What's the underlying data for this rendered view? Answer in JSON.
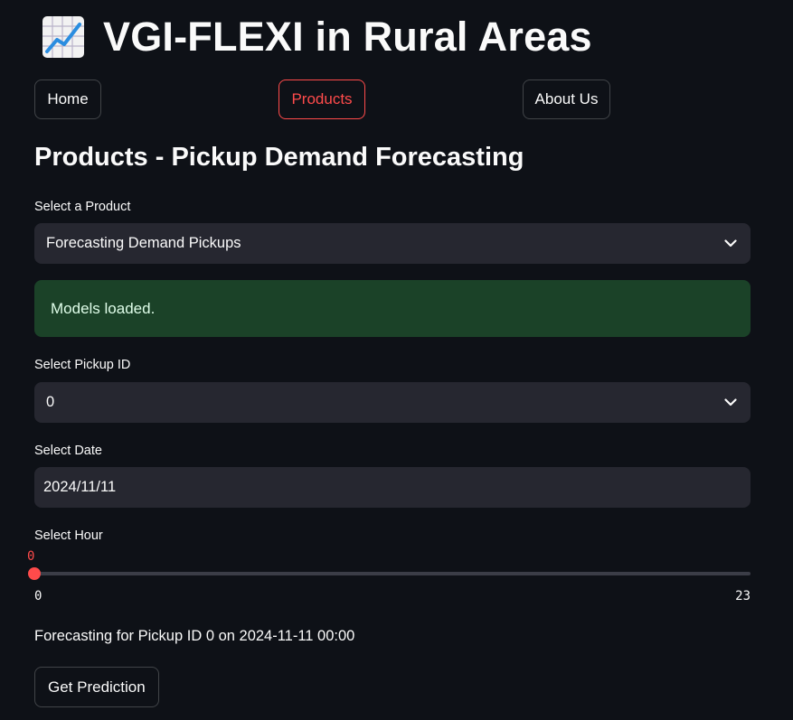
{
  "app": {
    "title": "VGI-FLEXI in Rural Areas",
    "title_icon": "chart-increasing-icon"
  },
  "nav": {
    "items": [
      {
        "label": "Home",
        "active": false
      },
      {
        "label": "Products",
        "active": true
      },
      {
        "label": "About Us",
        "active": false
      }
    ]
  },
  "section": {
    "title": "Products - Pickup Demand Forecasting"
  },
  "product_select": {
    "label": "Select a Product",
    "value": "Forecasting Demand Pickups"
  },
  "status": {
    "message": "Models loaded."
  },
  "pickup_select": {
    "label": "Select Pickup ID",
    "value": "0"
  },
  "date": {
    "label": "Select Date",
    "value": "2024/11/11"
  },
  "hour_slider": {
    "label": "Select Hour",
    "value": 0,
    "value_text": "0",
    "min": 0,
    "max": 23,
    "min_text": "0",
    "max_text": "23"
  },
  "forecast": {
    "text": "Forecasting for Pickup ID 0 on 2024-11-11 00:00"
  },
  "predict_button": {
    "label": "Get Prediction"
  },
  "colors": {
    "background": "#0e1117",
    "accent": "#ff4b4b",
    "input_bg": "#262730",
    "success_bg": "#1b4228"
  }
}
